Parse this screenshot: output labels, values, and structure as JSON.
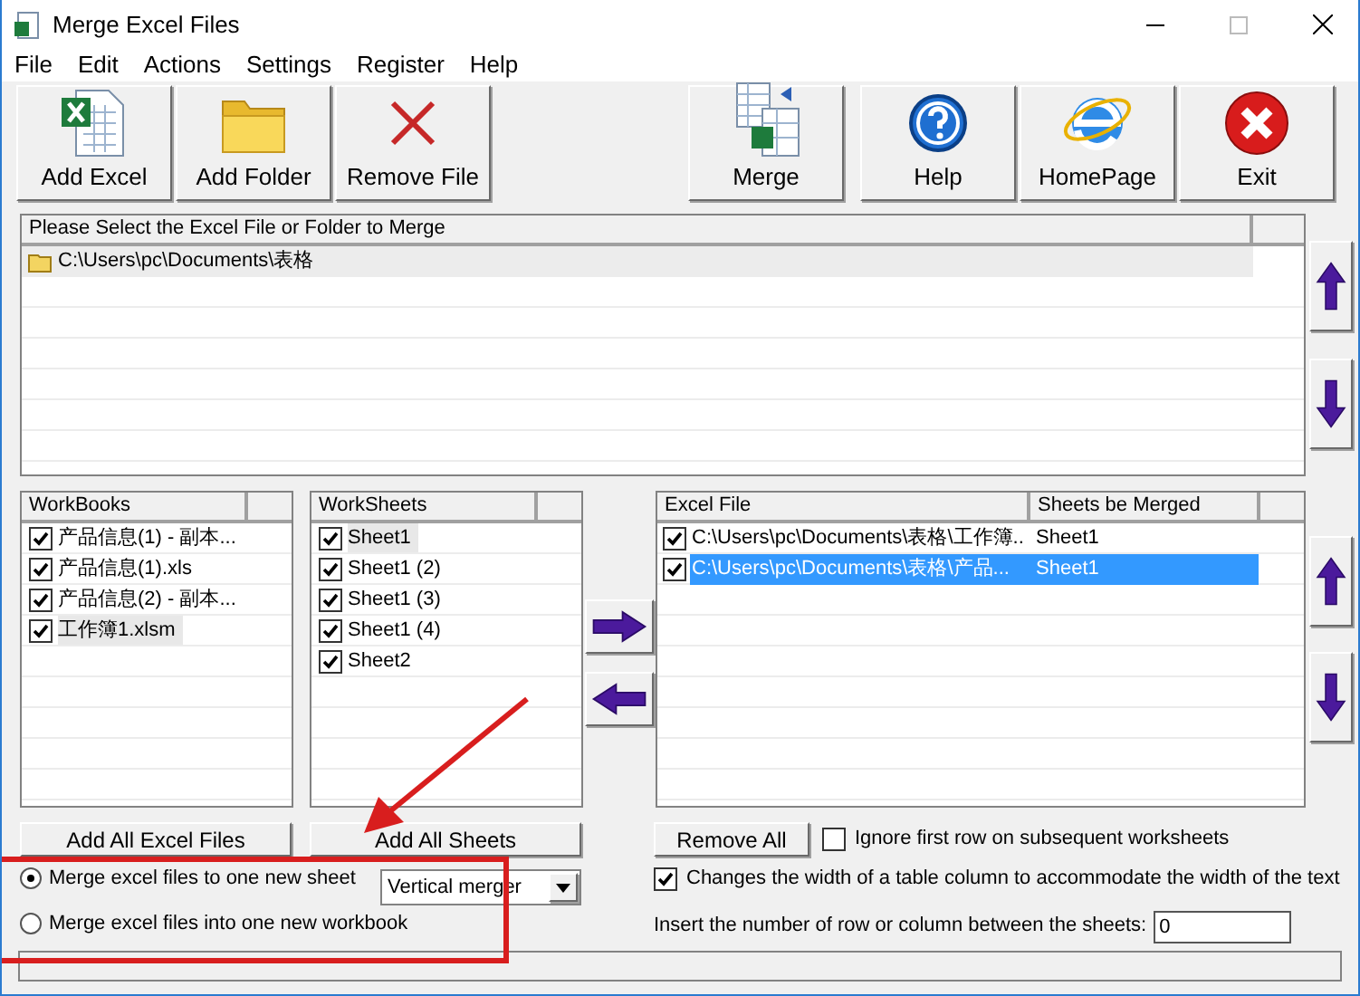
{
  "window": {
    "title": "Merge Excel Files"
  },
  "menu": [
    "File",
    "Edit",
    "Actions",
    "Settings",
    "Register",
    "Help"
  ],
  "toolbar_left": [
    {
      "label": "Add Excel",
      "kind": "excel"
    },
    {
      "label": "Add Folder",
      "kind": "folder"
    },
    {
      "label": "Remove File",
      "kind": "remove"
    }
  ],
  "toolbar_right": [
    {
      "label": "Merge",
      "kind": "merge"
    },
    {
      "label": "Help",
      "kind": "help"
    },
    {
      "label": "HomePage",
      "kind": "home"
    },
    {
      "label": "Exit",
      "kind": "exit"
    }
  ],
  "source_list": {
    "header": "Please Select the Excel File or Folder to Merge",
    "items": [
      {
        "path": "C:\\Users\\pc\\Documents\\表格",
        "selected": true
      }
    ]
  },
  "workbooks": {
    "header": "WorkBooks",
    "items": [
      {
        "name": "产品信息(1) - 副本...",
        "checked": true,
        "selected": false
      },
      {
        "name": "产品信息(1).xls",
        "checked": true,
        "selected": false
      },
      {
        "name": "产品信息(2) - 副本...",
        "checked": true,
        "selected": false
      },
      {
        "name": "工作簿1.xlsm",
        "checked": true,
        "selected": true
      }
    ]
  },
  "worksheets": {
    "header": "WorkSheets",
    "items": [
      {
        "name": "Sheet1",
        "checked": true,
        "selected": true
      },
      {
        "name": "Sheet1 (2)",
        "checked": true,
        "selected": false
      },
      {
        "name": "Sheet1 (3)",
        "checked": true,
        "selected": false
      },
      {
        "name": "Sheet1 (4)",
        "checked": true,
        "selected": false
      },
      {
        "name": "Sheet2",
        "checked": true,
        "selected": false
      }
    ]
  },
  "merge_list": {
    "columns": [
      "Excel File",
      "Sheets be Merged"
    ],
    "rows": [
      {
        "file": "C:\\Users\\pc\\Documents\\表格\\工作簿..",
        "sheets": "Sheet1",
        "checked": true,
        "selected": false
      },
      {
        "file": "C:\\Users\\pc\\Documents\\表格\\产品...",
        "sheets": "Sheet1",
        "checked": true,
        "selected": true
      }
    ]
  },
  "add_all_excel_button": "Add All Excel Files",
  "add_all_sheets_button": "Add All Sheets",
  "remove_all_button": "Remove All",
  "merge_modes": [
    {
      "label": "Merge excel files to one new sheet",
      "selected": true
    },
    {
      "label": "Merge excel files into one new workbook",
      "selected": false
    }
  ],
  "merge_direction": {
    "value": "Vertical merger"
  },
  "ignore_first_row": {
    "label": "Ignore first row on subsequent worksheets",
    "checked": false
  },
  "auto_width": {
    "label": "Changes the width of a table column to accommodate the width of the text",
    "checked": true
  },
  "insert_rows": {
    "label": "Insert the number of row or column between the sheets:",
    "value": "0"
  }
}
